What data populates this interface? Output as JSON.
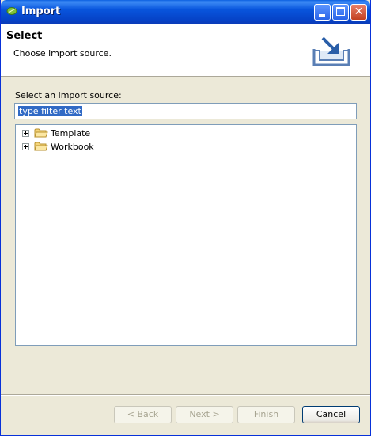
{
  "window": {
    "title": "Import"
  },
  "header": {
    "title": "Select",
    "description": "Choose import source."
  },
  "main": {
    "source_label": "Select an import source:",
    "filter": {
      "value": "type filter text"
    },
    "tree": [
      {
        "label": "Template",
        "icon": "folder-icon"
      },
      {
        "label": "Workbook",
        "icon": "folder-icon"
      }
    ]
  },
  "buttons": {
    "back": "< Back",
    "next": "Next >",
    "finish": "Finish",
    "cancel": "Cancel"
  },
  "colors": {
    "titlebar": "#0a52d9",
    "selection": "#316ac5",
    "dialog_bg": "#ece9d8",
    "folder": "#f5d57a"
  }
}
